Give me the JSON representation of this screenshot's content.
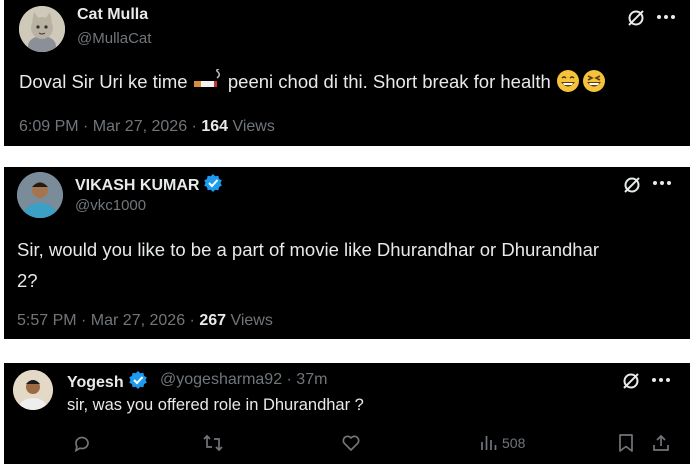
{
  "tweets": [
    {
      "name": "Cat Mulla",
      "handle": "@MullaCat",
      "text_part1": "Doval Sir Uri ke time ",
      "text_part2": " peeni chod di thi. Short break for health ",
      "time": "6:09 PM · Mar 27, 2026 · ",
      "views_count": "164",
      "views_label": " Views"
    },
    {
      "name": "VIKASH KUMAR",
      "handle": "@vkc1000",
      "text_line1": "Sir, would you like to be a part of movie like Dhurandhar or Dhurandhar",
      "text_line2": "2?",
      "time": "5:57 PM · Mar 27, 2026 · ",
      "views_count": "267",
      "views_label": " Views"
    },
    {
      "name": "Yogesh",
      "handle": "@yogesharma92 · 37m",
      "text": "sir, was you offered role in Dhurandhar ?",
      "views": "508"
    }
  ],
  "colors": {
    "background": "#000000",
    "text": "#e7e9ea",
    "muted": "#71767b",
    "verified": "#1d9bf0"
  },
  "icons": [
    "grok-icon",
    "more-icon",
    "verified-badge-icon",
    "reply-icon",
    "retweet-icon",
    "like-icon",
    "views-icon",
    "bookmark-icon",
    "share-icon",
    "cigarette-emoji",
    "grinning-emoji",
    "laughing-emoji"
  ]
}
